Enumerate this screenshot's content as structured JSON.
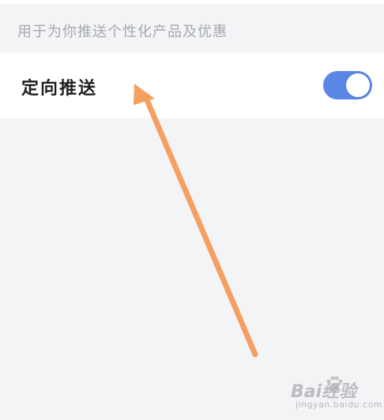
{
  "header": {
    "caption": "用于为你推送个性化产品及优惠"
  },
  "setting": {
    "label": "定向推送",
    "toggle_on": true,
    "toggle_color": "#5b86e6"
  },
  "annotation": {
    "arrow_color": "#f5a060"
  },
  "watermark": {
    "logo_text": "Bai经验",
    "site_text": "jingyan.baidu.com"
  }
}
